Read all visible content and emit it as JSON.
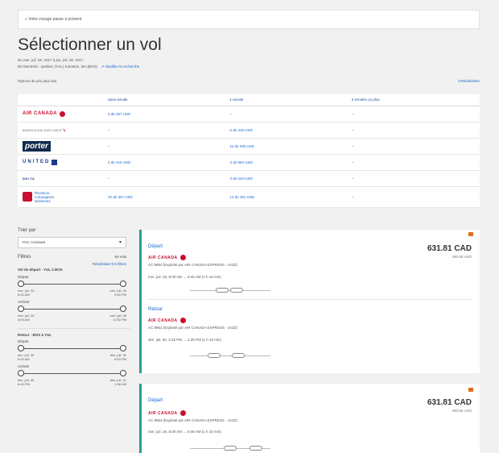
{
  "back_link": "« Votre voyage passe à présent",
  "page_title": "Sélectionner un vol",
  "trip_dates": "Du mer. juil. 26, 2017 à jeu. juil. 30, 2017",
  "trip_route": "De Montréal - Québec (YUL) à Boston, MA (BOS)",
  "modify_label": "✔ Modifier la recherche",
  "price_options_title": "Options de prix plus bas",
  "reset_label": "Réinitialiser",
  "grid": {
    "headers": [
      "Sans escale",
      "1 escale",
      "2 escales ou plus"
    ],
    "rows": [
      {
        "airline": "AIR CANADA",
        "cells": [
          "6 de 497 USD",
          "–",
          "–"
        ]
      },
      {
        "airline": "AMERICAN AIRLINES",
        "cells": [
          "–",
          "6 de 416 USD",
          "–"
        ]
      },
      {
        "airline": "porter",
        "cells": [
          "–",
          "11 de 336 USD",
          "–"
        ]
      },
      {
        "airline": "UNITED",
        "cells": [
          "4 de 415 USD",
          "3 de 564 USD",
          "–"
        ]
      },
      {
        "airline": "DELTA",
        "cells": [
          "–",
          "3 de 243 USD",
          "–"
        ]
      },
      {
        "airline": "Plusieurs compagnies aériennes",
        "cells": [
          "10 de 357 USD",
          "14 de 361 USD",
          "–"
        ]
      }
    ]
  },
  "sidebar": {
    "sort_label": "Trier par",
    "sort_value": "Prix: croissant",
    "filters_label": "Filtres",
    "filters_count": "64 vols",
    "reset_filters": "Réinitialiser les filtres",
    "outbound_title": "Vol de départ - YUL à BOS",
    "depart_label": "Départ",
    "depart_min": "mer. juil. 26",
    "depart_min_time": "6:00 AM",
    "depart_max": "mer. juil. 26",
    "depart_max_time": "9:50 PM",
    "arrive_label": "Arrivée",
    "arrive_min": "mer. juil. 26",
    "arrive_min_time": "8:03 AM",
    "arrive_max": "mer. juil. 26",
    "arrive_max_time": "11:50 PM",
    "return_title": "Retour - BOS à YUL",
    "ret_depart_label": "Départ",
    "ret_depart_min": "dim. juil. 30",
    "ret_depart_min_time": "5:00 AM",
    "ret_depart_max": "dim. juil. 30",
    "ret_depart_max_time": "9:53 PM",
    "ret_arrive_label": "Arrivée",
    "ret_arrive_min": "dim. juil. 30",
    "ret_arrive_min_time": "8:43 PM",
    "ret_arrive_max": "dim. juil. 31",
    "ret_arrive_max_time": "1:06 AM"
  },
  "cards": [
    {
      "dep_title": "Départ",
      "dep_airline": "AIR CANADA",
      "dep_flight": "AC 8954 (Exploité par AIR CANADA EXPRESS - JAZZ)",
      "dep_times": "mer. juil. 26, 8:30 AM → 9:46 AM (1 h 16 min)",
      "ret_title": "Retour",
      "ret_airline": "AIR CANADA",
      "ret_flight": "AC 8961 (Exploité par AIR CANADA EXPRESS - JAZZ)",
      "ret_times": "dim. juil. 30, 3:15 PM → 4:30 PM (1 h 15 min)",
      "price": "631.81 CAD",
      "usd": "490.55 USD"
    },
    {
      "dep_title": "Départ",
      "dep_airline": "AIR CANADA",
      "dep_flight": "AC 8954 (Exploité par AIR CANADA EXPRESS - JAZZ)",
      "dep_times": "mer. juil. 26, 8:30 AM → 9:46 AM (1 h 16 min)",
      "price": "631.81 CAD",
      "usd": "490.55 USD"
    }
  ],
  "colors": {
    "accent": "#1a66c9",
    "brand_red": "#c8102e",
    "card_border": "#2a9d8f"
  }
}
